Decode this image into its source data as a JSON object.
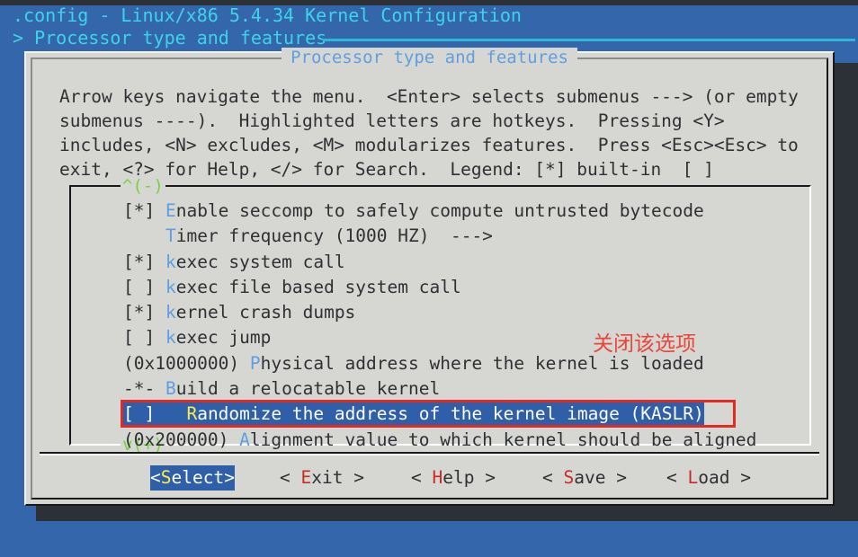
{
  "header": {
    "title": ".config - Linux/x86 5.4.34 Kernel Configuration",
    "breadcrumb": "> Processor type and features"
  },
  "dialog": {
    "title": "Processor type and features",
    "help_text": "Arrow keys navigate the menu.  <Enter> selects submenus ---> (or empty\nsubmenus ----).  Highlighted letters are hotkeys.  Pressing <Y>\nincludes, <N> excludes, <M> modularizes features.  Press <Esc><Esc> to\nexit, <?> for Help, </> for Search.  Legend: [*] built-in  [ ]",
    "scroll_up": "^(-)",
    "scroll_down": "v(+)"
  },
  "menu": {
    "items": [
      {
        "prefix": "[*] ",
        "hotkey": "E",
        "rest": "nable seccomp to safely compute untrusted bytecode",
        "selected": false
      },
      {
        "prefix": "    ",
        "hotkey": "T",
        "rest": "imer frequency (1000 HZ)  --->",
        "selected": false
      },
      {
        "prefix": "[*] ",
        "hotkey": "k",
        "rest": "exec system call",
        "selected": false
      },
      {
        "prefix": "[ ] ",
        "hotkey": "k",
        "rest": "exec file based system call",
        "selected": false
      },
      {
        "prefix": "[*] ",
        "hotkey": "k",
        "rest": "ernel crash dumps",
        "selected": false
      },
      {
        "prefix": "[ ] ",
        "hotkey": "k",
        "rest": "exec jump",
        "selected": false
      },
      {
        "prefix": "(0x1000000) ",
        "hotkey": "P",
        "rest": "hysical address where the kernel is loaded",
        "selected": false
      },
      {
        "prefix": "-*- ",
        "hotkey": "B",
        "rest": "uild a relocatable kernel",
        "selected": false
      },
      {
        "prefix": "[ ]   ",
        "hotkey": "R",
        "rest": "andomize the address of the kernel image (KASLR)",
        "selected": true
      },
      {
        "prefix": "(0x200000) ",
        "hotkey": "A",
        "rest": "lignment value to which kernel should be aligned",
        "selected": false
      }
    ]
  },
  "annotation": {
    "text": "关闭该选项",
    "color": "#e8453c"
  },
  "buttons": [
    {
      "pre": "<",
      "hotkey": "S",
      "post": "elect>",
      "active": true,
      "name": "select"
    },
    {
      "pre": "< ",
      "hotkey": "E",
      "post": "xit >",
      "active": false,
      "name": "exit"
    },
    {
      "pre": "< ",
      "hotkey": "H",
      "post": "elp >",
      "active": false,
      "name": "help"
    },
    {
      "pre": "< ",
      "hotkey": "S",
      "post": "ave >",
      "active": false,
      "name": "save"
    },
    {
      "pre": "< ",
      "hotkey": "L",
      "post": "oad >",
      "active": false,
      "name": "load"
    }
  ],
  "colors": {
    "background": "#3366ab",
    "dialog_bg": "#d6d7d2",
    "header_text": "#3fd3e8",
    "hotkey": "#5f9ee0",
    "selection": "#2f5fa8",
    "scroll_marker": "#7ad13f",
    "button_hotkey": "#cb2b24",
    "annotation": "#e8453c"
  }
}
